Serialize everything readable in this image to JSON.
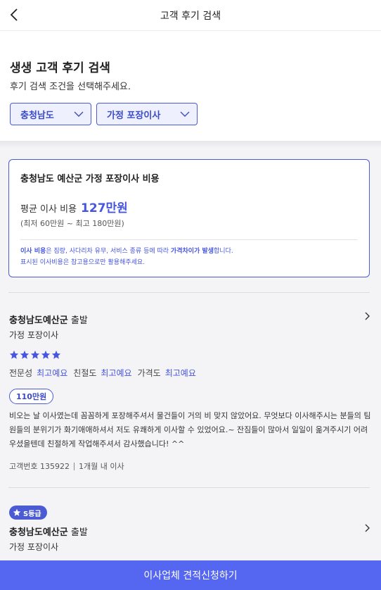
{
  "header": {
    "title": "고객 후기 검색",
    "back_icon": "chevron-left-icon"
  },
  "search": {
    "heading": "생생 고객 후기 검색",
    "subtitle": "후기 검색 조건을 선택해주세요.",
    "region_select": "충청남도",
    "type_select": "가정 포장이사"
  },
  "cost_card": {
    "title": "충청남도 예산군 가정 포장이사 비용",
    "avg_label": "평균 이사 비용",
    "avg_value": "127만원",
    "range": "(최저 60만원 ~ 최고 180만원)",
    "note1_a": "이사 비용",
    "note1_b": "은 짐량, 사다리차 유무, 서비스 종류 등에 따라 ",
    "note1_c": "가격차이가 발생",
    "note1_d": "합니다.",
    "note2": "표시된 이사비용은 참고용으로만 활용해주세요."
  },
  "reviews": [
    {
      "region": "충청남도예산군",
      "depart": " 출발",
      "move_type": "가정 포장이사",
      "stars": 5,
      "ratings": [
        {
          "label": "전문성",
          "value": "최고예요"
        },
        {
          "label": "친절도",
          "value": "최고예요"
        },
        {
          "label": "가격도",
          "value": "최고예요"
        }
      ],
      "price": "110만원",
      "text": "비오는 날 이사였는데 꼼꼼하게 포장해주셔서 물건들이 거의 비 맞지 않았어요. 무엇보다 이사해주시는 분들의 팀원들의 분위기가 화기애애하셔서 저도 유쾌하게 이사할 수 있었어요.~ 잔짐들이 많아서 일일이 옮겨주시기 어려우셨을텐데 친절하게 작업해주셔서 감사했습니다! ^^",
      "customer_no": "고객번호 135922",
      "when": "1개월 내 이사"
    },
    {
      "badge": "S등급",
      "region": "충청남도예산군",
      "depart": " 출발",
      "move_type": "가정 포장이사"
    }
  ],
  "cta": {
    "label": "이사업체 견적신청하기"
  },
  "colors": {
    "accent": "#4a5bd4",
    "cta": "#5566f0",
    "star": "#4656e0"
  }
}
